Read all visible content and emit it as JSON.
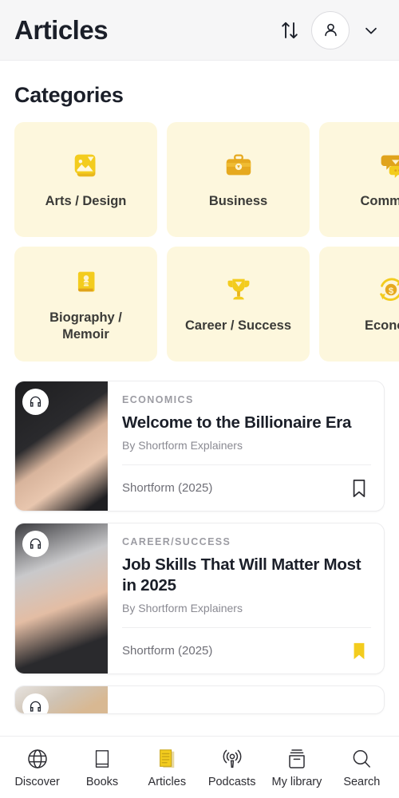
{
  "header": {
    "title": "Articles",
    "sort_icon": "sort-arrows-icon",
    "avatar_icon": "person-icon",
    "chevron_icon": "chevron-down-icon"
  },
  "categories": {
    "section_title": "Categories",
    "rows": [
      [
        {
          "label": "Arts / Design",
          "icon": "image-picture-icon"
        },
        {
          "label": "Business",
          "icon": "briefcase-icon"
        },
        {
          "label": "Communi",
          "icon": "speech-bubbles-icon"
        }
      ],
      [
        {
          "label": "Biography /\nMemoir",
          "icon": "book-icon"
        },
        {
          "label": "Career / Success",
          "icon": "trophy-icon"
        },
        {
          "label": "Econom",
          "icon": "money-cycle-icon"
        }
      ]
    ]
  },
  "articles": [
    {
      "kicker": "ECONOMICS",
      "title": "Welcome to the Billionaire Era",
      "byline": "By Shortform Explainers",
      "source": "Shortform (2025)",
      "bookmarked": false,
      "audio_badge": "headphones-icon"
    },
    {
      "kicker": "CAREER/SUCCESS",
      "title": "Job Skills That Will Matter Most in 2025",
      "byline": "By Shortform Explainers",
      "source": "Shortform (2025)",
      "bookmarked": true,
      "audio_badge": "headphones-icon"
    }
  ],
  "bottom_nav": {
    "items": [
      {
        "label": "Discover",
        "icon": "globe-icon",
        "active": false
      },
      {
        "label": "Books",
        "icon": "book-icon",
        "active": false
      },
      {
        "label": "Articles",
        "icon": "document-icon",
        "active": true
      },
      {
        "label": "Podcasts",
        "icon": "podcast-icon",
        "active": false
      },
      {
        "label": "My library",
        "icon": "archive-box-icon",
        "active": false
      },
      {
        "label": "Search",
        "icon": "magnifier-icon",
        "active": false
      }
    ]
  },
  "colors": {
    "accent_yellow": "#f3cc1e",
    "icon_gold": "#e6a91f",
    "card_cream": "#fdf7dd",
    "text_dark": "#1b1f29",
    "text_muted": "#8a8a92",
    "header_bg": "#f6f6f7"
  }
}
